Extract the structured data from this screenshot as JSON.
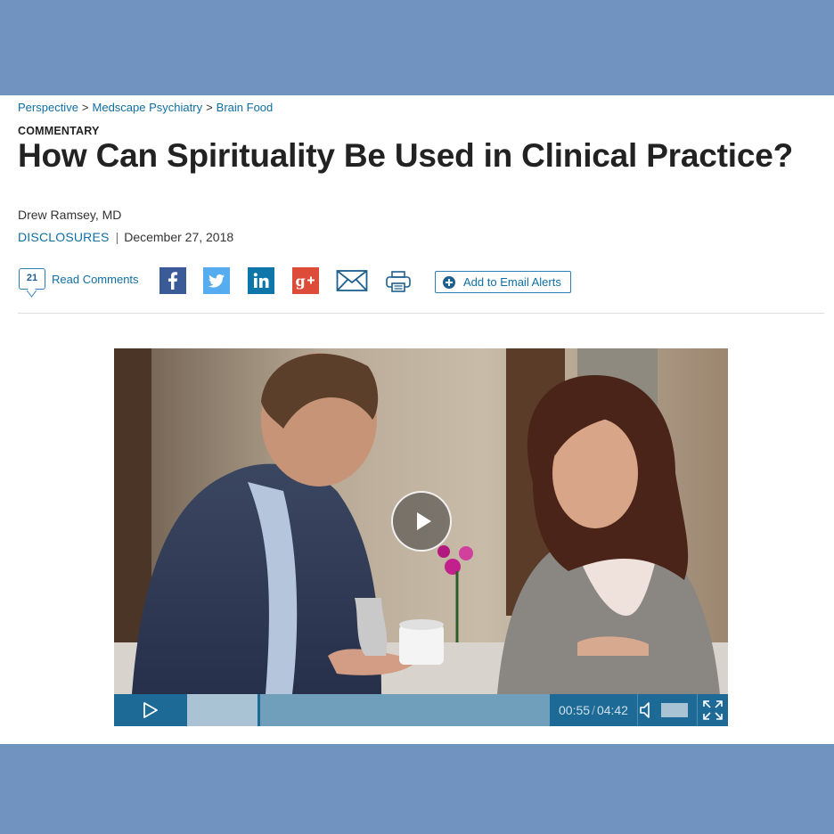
{
  "breadcrumb": {
    "items": [
      "Perspective",
      "Medscape Psychiatry",
      "Brain Food"
    ],
    "separator": ">"
  },
  "article": {
    "kicker": "COMMENTARY",
    "title": "How Can Spirituality Be Used in Clinical Practice?",
    "author": "Drew Ramsey, MD",
    "disclosures_label": "DISCLOSURES",
    "meta_separator": "|",
    "date": "December 27, 2018"
  },
  "toolbar": {
    "comment_count": "21",
    "comments_label": "Read Comments",
    "share_icons": [
      "facebook-icon",
      "twitter-icon",
      "linkedin-icon",
      "google-plus-icon",
      "email-icon",
      "print-icon"
    ],
    "alerts_label": "Add to Email Alerts"
  },
  "video": {
    "current_time": "00:55",
    "time_separator": "/",
    "duration": "04:42",
    "progress_fraction": 0.195,
    "volume_fraction": 1.0
  },
  "colors": {
    "background_band": "#7193c0",
    "link": "#0f6fa3",
    "player_controls": "#1e6a96",
    "progress_track": "#6f9fba",
    "progress_played": "#a9c3d4"
  }
}
